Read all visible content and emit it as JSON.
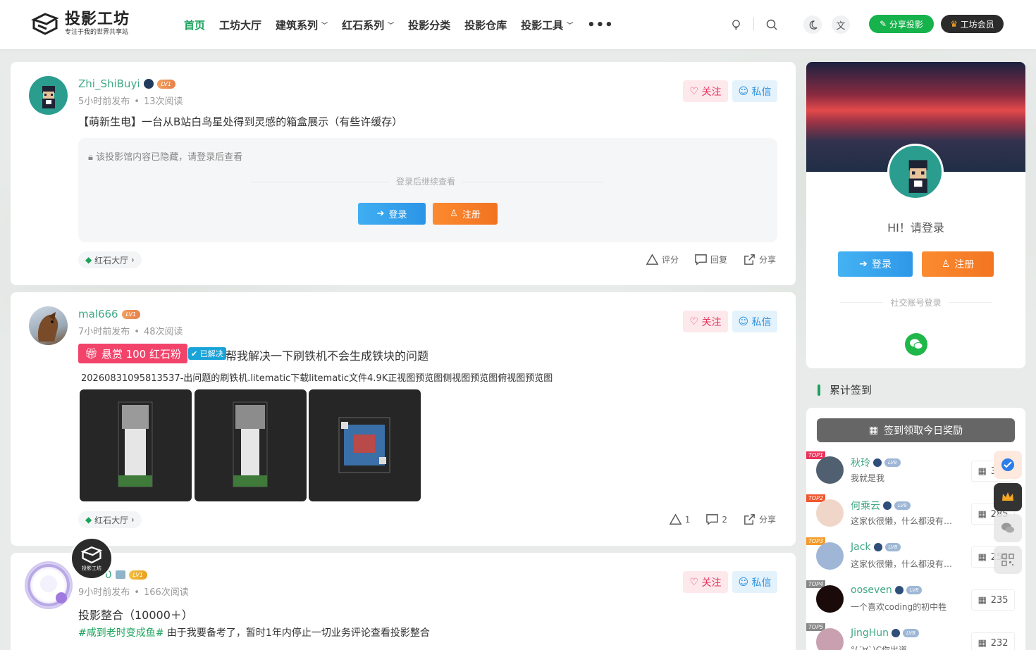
{
  "site": {
    "logo_title": "投影工坊",
    "logo_sub": "专注于我的世界共享站"
  },
  "nav": {
    "items": [
      {
        "label": "首页",
        "active": true,
        "dropdown": false
      },
      {
        "label": "工坊大厅",
        "active": false,
        "dropdown": false
      },
      {
        "label": "建筑系列",
        "active": false,
        "dropdown": true
      },
      {
        "label": "红石系列",
        "active": false,
        "dropdown": true
      },
      {
        "label": "投影分类",
        "active": false,
        "dropdown": false
      },
      {
        "label": "投影仓库",
        "active": false,
        "dropdown": false
      },
      {
        "label": "投影工具",
        "active": false,
        "dropdown": true
      }
    ],
    "more": "•••"
  },
  "header": {
    "share_label": "分享投影",
    "vip_label": "工坊会员"
  },
  "posts": [
    {
      "user": "Zhi_ShiBuyi",
      "level": "LV1",
      "time": "5小时前发布",
      "reads": "13次阅读",
      "title": "【萌新生电】一台从B站白鸟星处得到灵感的箱盒展示（有些许缓存）",
      "hidden_notice": "该投影馆内容已隐藏，请登录后查看",
      "continue_text": "登录后继续查看",
      "login": "登录",
      "register": "注册",
      "tag": "红石大厅",
      "rate": "评分",
      "reply": "回复",
      "share": "分享",
      "follow": "关注",
      "pm": "私信"
    },
    {
      "user": "mal666",
      "level": "LV1",
      "time": "7小时前发布",
      "reads": "48次阅读",
      "bounty": "悬赏 100 红石粉",
      "solved": "已解决",
      "title": "帮我解决一下刷铁机不会生成铁块的问题",
      "excerpt": "20260831095813537-出问题的刷铁机.litematic下载litematic文件4.9K正视图预览图侧视图预览图俯视图预览图",
      "tag": "红石大厅",
      "likes": "1",
      "comments": "2",
      "share": "分享",
      "follow": "关注",
      "pm": "私信"
    },
    {
      "user_partial": "0",
      "level": "LV1",
      "time": "9小时前发布",
      "reads": "166次阅读",
      "title": "投影整合（10000＋）",
      "topic": "#咸到老时变成鱼#",
      "excerpt": "由于我要备考了，暂时1年内停止一切业务评论查看投影整合",
      "follow": "关注",
      "pm": "私信",
      "logo_overlay": "投影工坊"
    }
  ],
  "sidebar": {
    "greeting": "HI！请登录",
    "login": "登录",
    "register": "注册",
    "social_login": "社交账号登录",
    "signin_title": "累计签到",
    "signin_button": "签到领取今日奖励",
    "ranks": [
      {
        "badge": "TOP1",
        "name": "秋玲",
        "level": "LV9",
        "desc": "我就是我",
        "count": "300",
        "badge_color": "#e8335a"
      },
      {
        "badge": "TOP2",
        "name": "何乘云",
        "level": "LV9",
        "desc": "这家伙很懒，什么都没有写...",
        "count": "285",
        "badge_color": "#f0562e"
      },
      {
        "badge": "TOP3",
        "name": "Jack",
        "level": "LV8",
        "desc": "这家伙很懒，什么都没有写...",
        "count": "258",
        "badge_color": "#f39a2a"
      },
      {
        "badge": "TOP4",
        "name": "ooseven",
        "level": "LV8",
        "desc": "一个喜欢coding的初中牲",
        "count": "235",
        "badge_color": "#888888"
      },
      {
        "badge": "TOP5",
        "name": "JingHun",
        "level": "LV8",
        "desc": "°(´∀`)C你出道",
        "count": "232",
        "badge_color": "#888888"
      }
    ]
  },
  "colors": {
    "accent": "#19a35b",
    "follow": "#e9335b",
    "pm": "#2d92de",
    "login": "#3aa6ef",
    "register": "#f77f28"
  }
}
